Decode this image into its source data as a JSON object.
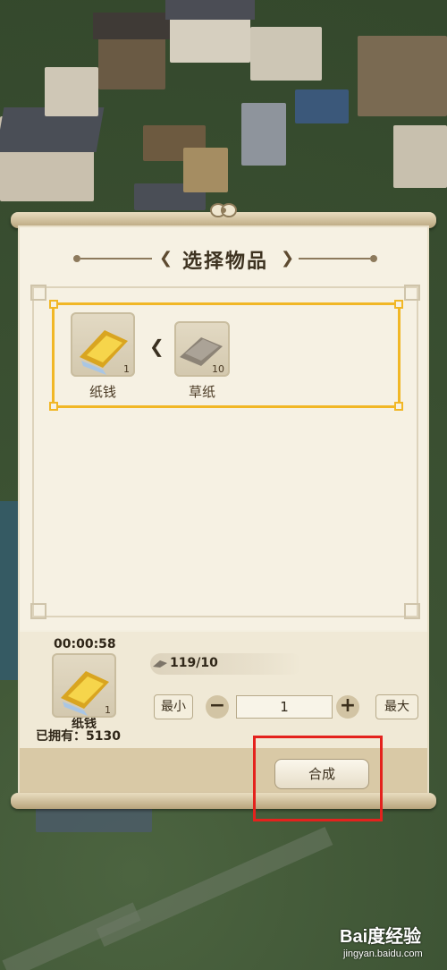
{
  "dialog": {
    "title": "选择物品"
  },
  "recipe": {
    "result": {
      "name": "纸钱",
      "count": "1"
    },
    "ingredient": {
      "name": "草纸",
      "count": "10"
    }
  },
  "craft_panel": {
    "timer": "00:00:58",
    "item": {
      "name": "纸钱",
      "count": "1"
    },
    "owned_label": "已拥有：",
    "owned_value": "5130",
    "material_text": "119/10",
    "min_label": "最小",
    "max_label": "最大",
    "minus": "−",
    "plus": "+",
    "quantity": "1",
    "craft_label": "合成"
  },
  "watermark": {
    "brand": "Bai度经验",
    "url": "jingyan.baidu.com"
  },
  "colors": {
    "highlight_box": "#e4221d",
    "recipe_border": "#f1b726",
    "paper": "#f4efe0"
  },
  "icons": [
    "paper-money-icon",
    "straw-paper-icon",
    "arrow-left-icon",
    "minus-icon",
    "plus-icon"
  ]
}
